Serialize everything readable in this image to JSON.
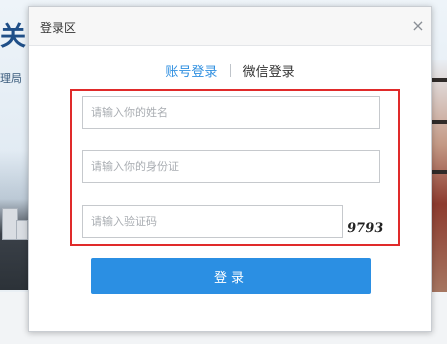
{
  "background": {
    "title_fragment": "关",
    "subtitle_fragment": "理局"
  },
  "modal": {
    "title": "登录区",
    "close_glyph": "×"
  },
  "tabs": [
    {
      "label": "账号登录",
      "active": true
    },
    {
      "label": "微信登录",
      "active": false
    }
  ],
  "form": {
    "name_placeholder": "请输入你的姓名",
    "id_placeholder": "请输入你的身份证",
    "captcha_placeholder": "请输入验证码",
    "captcha_text": "9793"
  },
  "submit_label": "登录",
  "colors": {
    "accent": "#2b8fe3",
    "tab_active": "#2f8fe0",
    "highlight": "#e02a2a"
  }
}
